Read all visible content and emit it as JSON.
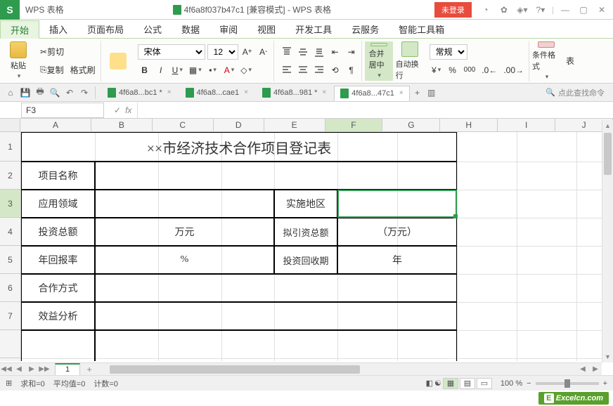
{
  "titlebar": {
    "app_name": "WPS 表格",
    "doc_title": "4f6a8f037b47c1 [兼容模式] - WPS 表格",
    "login_badge": "未登录"
  },
  "menus": [
    "开始",
    "插入",
    "页面布局",
    "公式",
    "数据",
    "审阅",
    "视图",
    "开发工具",
    "云服务",
    "智能工具箱"
  ],
  "ribbon": {
    "paste": "粘贴",
    "cut": "剪切",
    "copy": "复制",
    "format_painter": "格式刷",
    "font_name": "宋体",
    "font_size": "12",
    "merge_center": "合并居中",
    "wrap_text": "自动换行",
    "number_format": "常规",
    "cond_format": "条件格式"
  },
  "doctabs": [
    {
      "label": "4f6a8...bc1 *"
    },
    {
      "label": "4f6a8...cae1"
    },
    {
      "label": "4f6a8...981 *"
    },
    {
      "label": "4f6a8...47c1"
    }
  ],
  "search_hint": "点此查找命令",
  "namebox": "F3",
  "columns": [
    "A",
    "B",
    "C",
    "D",
    "E",
    "F",
    "G",
    "H",
    "I",
    "J"
  ],
  "rows": [
    "1",
    "2",
    "3",
    "4",
    "5",
    "6",
    "7"
  ],
  "table": {
    "title": "××市经济技术合作项目登记表",
    "r2a": "项目名称",
    "r3a": "应用领域",
    "r3e": "实施地区",
    "r4a": "投资总额",
    "r4c": "万元",
    "r4e": "拟引资总额",
    "r4g": "（万元）",
    "r5a": "年回报率",
    "r5c": "%",
    "r5e": "投资回收期",
    "r5g": "年",
    "r6a": "合作方式",
    "r7a": "效益分析"
  },
  "sheet_name": "1",
  "status": {
    "sum": "求和=0",
    "avg": "平均值=0",
    "count": "计数=0",
    "zoom": "100 %"
  },
  "watermark": "Excelcn.com"
}
